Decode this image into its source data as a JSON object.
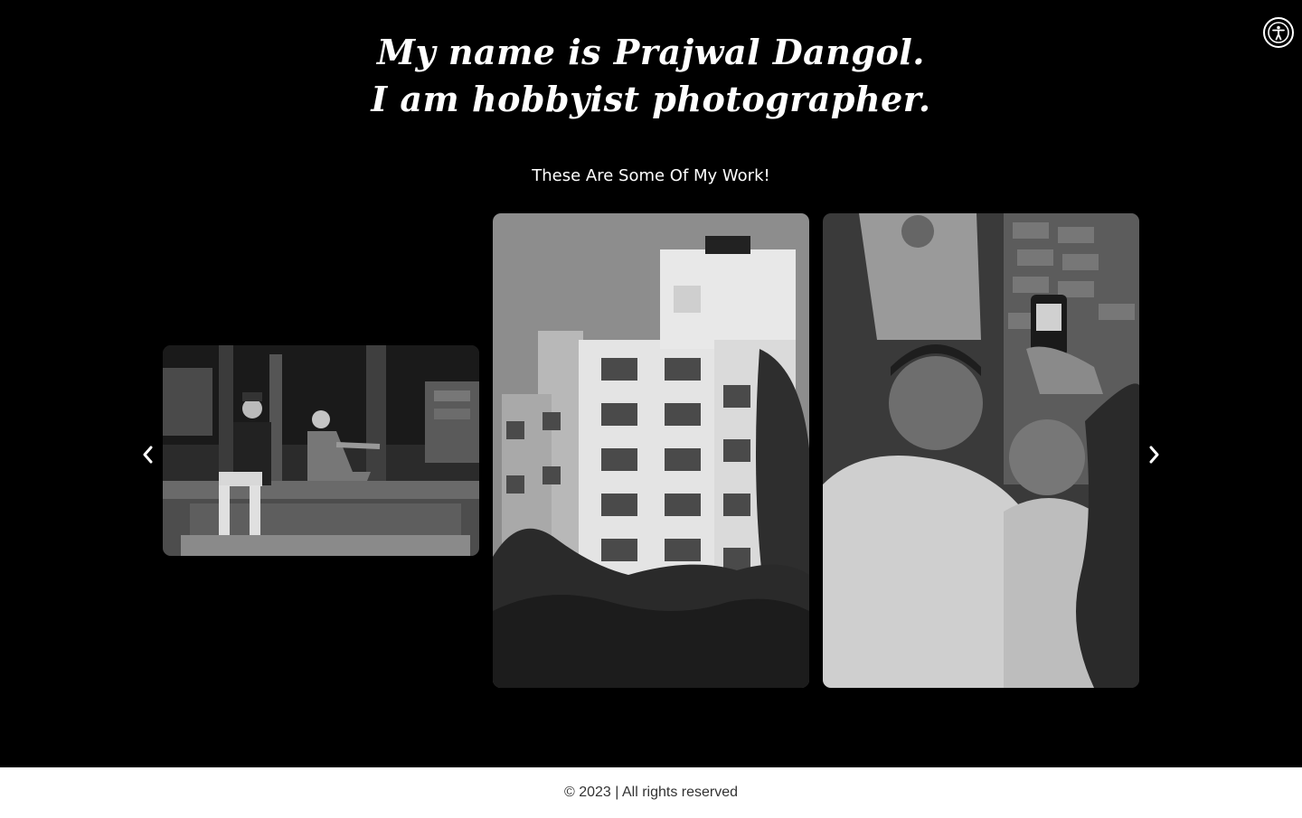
{
  "hero": {
    "line1": "My name is Prajwal Dangol.",
    "line2": "I am hobbyist photographer."
  },
  "gallery": {
    "heading": "These Are Some Of My Work!",
    "slides": [
      {
        "icon": "photo-elderly-couple"
      },
      {
        "icon": "photo-building"
      },
      {
        "icon": "photo-men-selfie"
      }
    ],
    "prev_icon": "chevron-left-icon",
    "next_icon": "chevron-right-icon"
  },
  "accessibility": {
    "icon": "accessibility-icon"
  },
  "footer": {
    "copyright": "© 2023 | All rights reserved"
  },
  "colors": {
    "background": "#000000",
    "footer_bg": "#ffffff",
    "footer_text": "#333333"
  }
}
